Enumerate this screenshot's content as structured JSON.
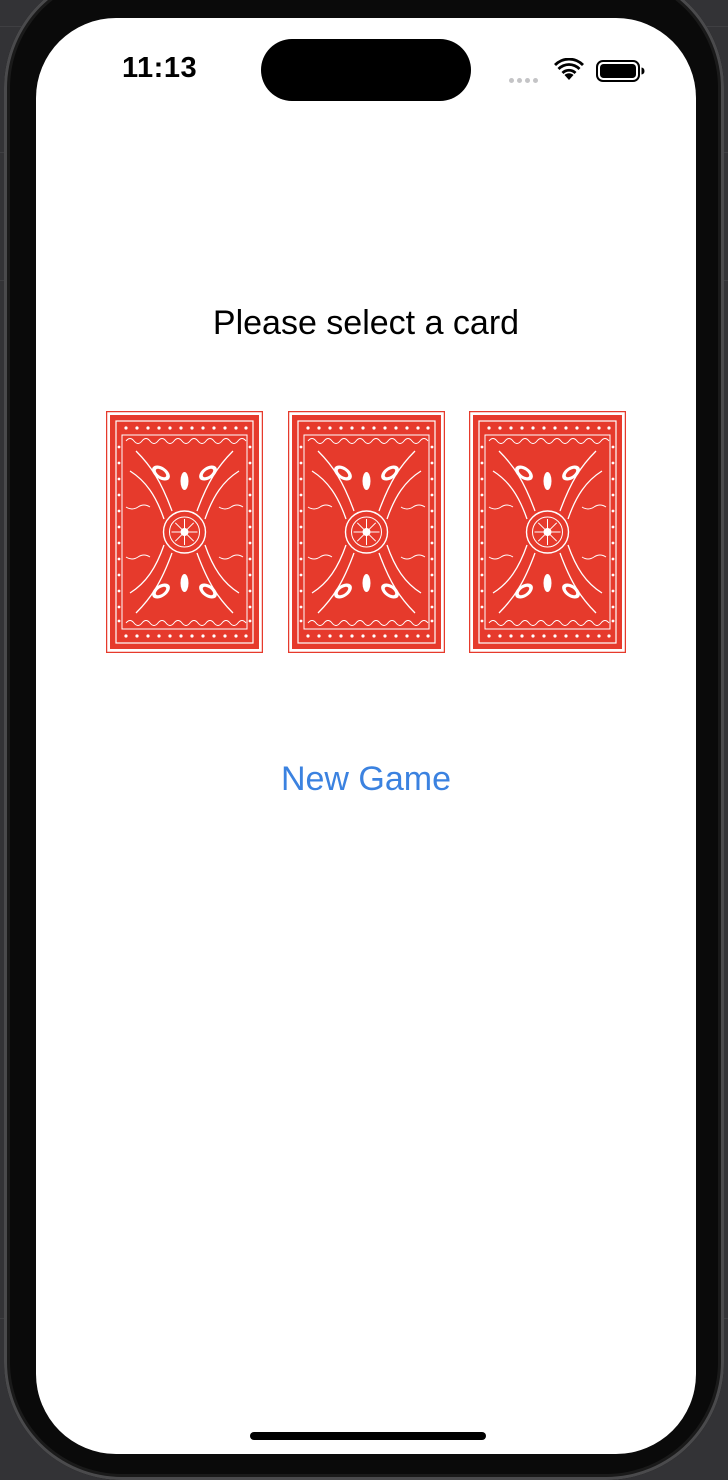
{
  "status_bar": {
    "time": "11:13",
    "wifi_icon": "wifi-icon",
    "battery_icon": "battery-icon",
    "signal_icon": "cellular-dots-icon"
  },
  "main": {
    "prompt": "Please select a card",
    "cards": [
      {
        "face": "back"
      },
      {
        "face": "back"
      },
      {
        "face": "back"
      }
    ],
    "new_game_label": "New Game"
  },
  "colors": {
    "card_red": "#e63a2c",
    "link_blue": "#3b82e0",
    "background": "#ffffff"
  }
}
